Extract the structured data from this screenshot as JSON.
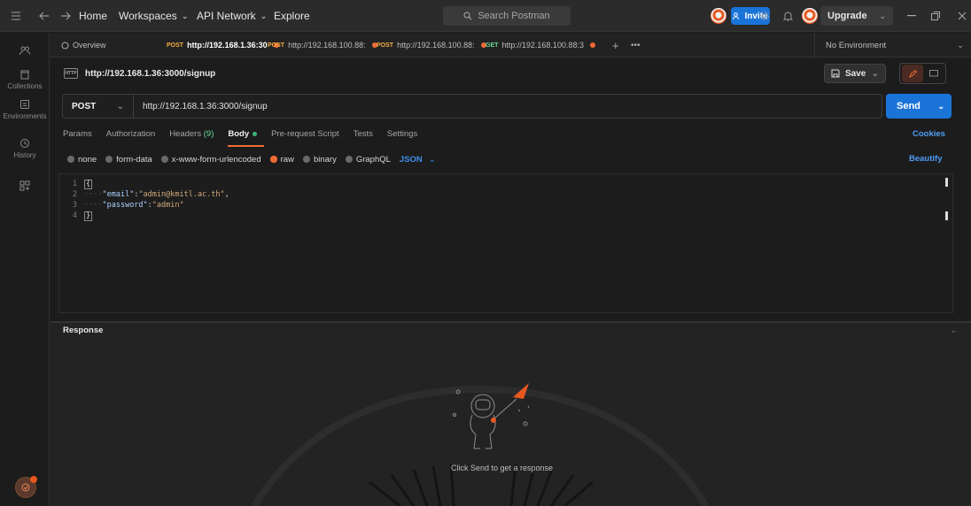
{
  "topbar": {
    "home": "Home",
    "workspaces": "Workspaces",
    "api_network": "API Network",
    "explore": "Explore",
    "search_placeholder": "Search Postman",
    "invite": "Invite",
    "upgrade": "Upgrade"
  },
  "sidebar": {
    "items": [
      {
        "label": "",
        "icon": "team-icon"
      },
      {
        "label": "Collections",
        "icon": "collections-icon"
      },
      {
        "label": "Environments",
        "icon": "environments-icon"
      },
      {
        "label": "History",
        "icon": "history-icon"
      },
      {
        "label": "",
        "icon": "add-apps-icon"
      }
    ]
  },
  "tabs": {
    "overview": "Overview",
    "items": [
      {
        "method": "POST",
        "url": "http://192.168.1.36:30",
        "active": true
      },
      {
        "method": "POST",
        "url": "http://192.168.100.88:",
        "active": false
      },
      {
        "method": "POST",
        "url": "http://192.168.100.88:",
        "active": false
      },
      {
        "method": "GET",
        "url": "http://192.168.100.88:3",
        "active": false
      }
    ],
    "environment": "No Environment"
  },
  "request": {
    "badge": "HTTP",
    "title": "http://192.168.1.36:3000/signup",
    "save": "Save",
    "method": "POST",
    "url": "http://192.168.1.36:3000/signup",
    "send": "Send"
  },
  "subtabs": {
    "params": "Params",
    "authorization": "Authorization",
    "headers": "Headers",
    "headers_count": "(9)",
    "body": "Body",
    "pre_request": "Pre-request Script",
    "tests": "Tests",
    "settings": "Settings",
    "cookies": "Cookies"
  },
  "body_types": {
    "none": "none",
    "form_data": "form-data",
    "urlencoded": "x-www-form-urlencoded",
    "raw": "raw",
    "binary": "binary",
    "graphql": "GraphQL",
    "format": "JSON",
    "beautify": "Beautify"
  },
  "editor": {
    "line_numbers": [
      "1",
      "2",
      "3",
      "4"
    ],
    "open_brace": "{",
    "close_brace": "}",
    "email_key": "\"email\"",
    "email_value": "\"admin@kmitl.ac.th\"",
    "password_key": "\"password\"",
    "password_value": "\"admin\""
  },
  "response": {
    "title": "Response",
    "empty_message": "Click Send to get a response"
  },
  "colors": {
    "accent_blue": "#1a74d8",
    "accent_orange": "#f06b35",
    "background": "#1c1c1c"
  }
}
